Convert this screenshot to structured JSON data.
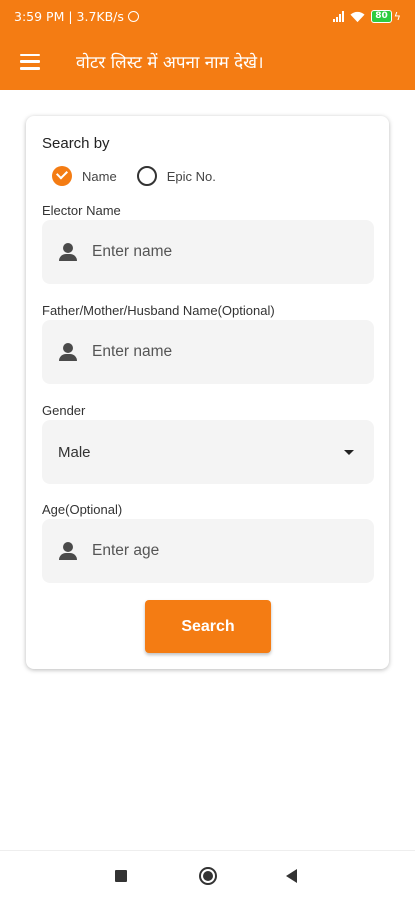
{
  "statusbar": {
    "time": "3:59 PM | 3.7KB/s",
    "battery": "80"
  },
  "colors": {
    "accent": "#f47c13",
    "field_bg": "#f4f4f4"
  },
  "appbar": {
    "title": "वोटर लिस्ट में अपना नाम देखे।"
  },
  "form": {
    "search_by_label": "Search by",
    "options": [
      {
        "label": "Name",
        "selected": true
      },
      {
        "label": "Epic No.",
        "selected": false
      }
    ],
    "elector_name": {
      "label": "Elector Name",
      "placeholder": "Enter name"
    },
    "relative_name": {
      "label": "Father/Mother/Husband Name(Optional)",
      "placeholder": "Enter name"
    },
    "gender": {
      "label": "Gender",
      "value": "Male"
    },
    "age": {
      "label": "Age(Optional)",
      "placeholder": "Enter age"
    },
    "submit_label": "Search"
  }
}
